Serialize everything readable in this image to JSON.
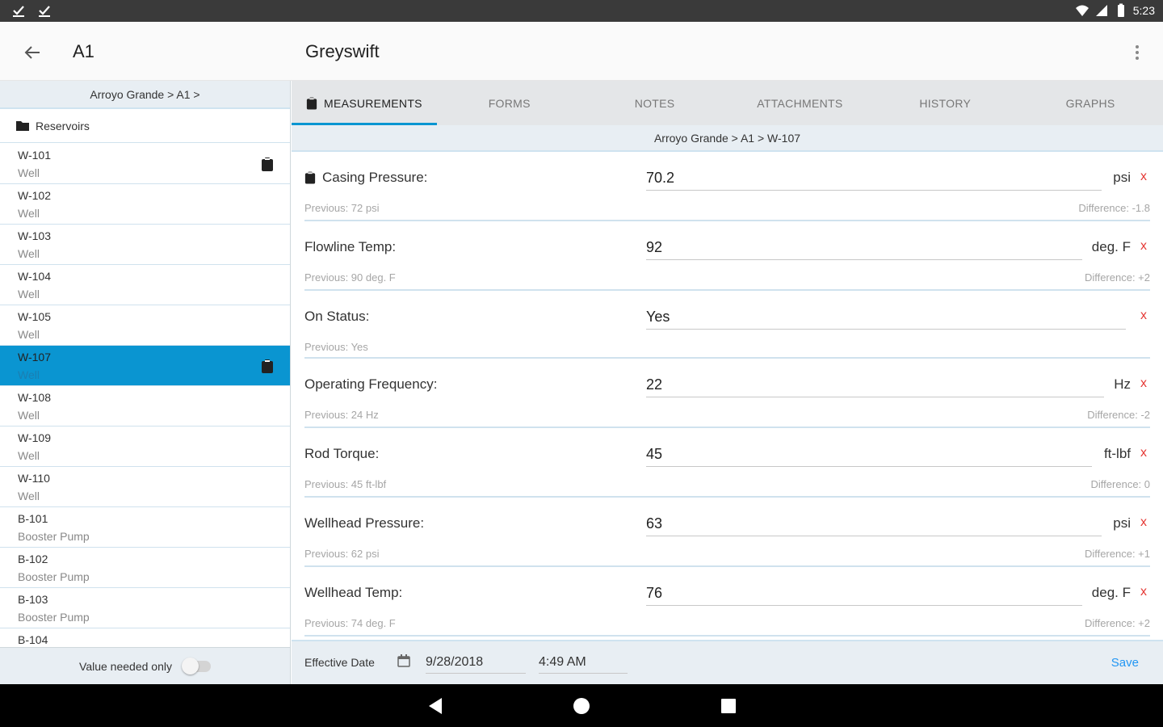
{
  "status_bar": {
    "time": "5:23"
  },
  "app_bar": {
    "left_title": "A1",
    "main_title": "Greyswift"
  },
  "left_pane": {
    "breadcrumb": "Arroyo Grande > A1 >",
    "folder_label": "Reservoirs",
    "items": [
      {
        "name": "W-101",
        "type": "Well"
      },
      {
        "name": "W-102",
        "type": "Well"
      },
      {
        "name": "W-103",
        "type": "Well"
      },
      {
        "name": "W-104",
        "type": "Well"
      },
      {
        "name": "W-105",
        "type": "Well"
      },
      {
        "name": "W-107",
        "type": "Well"
      },
      {
        "name": "W-108",
        "type": "Well"
      },
      {
        "name": "W-109",
        "type": "Well"
      },
      {
        "name": "W-110",
        "type": "Well"
      },
      {
        "name": "B-101",
        "type": "Booster Pump"
      },
      {
        "name": "B-102",
        "type": "Booster Pump"
      },
      {
        "name": "B-103",
        "type": "Booster Pump"
      },
      {
        "name": "B-104",
        "type": ""
      }
    ],
    "footer_label": "Value needed only"
  },
  "tabs": [
    "MEASUREMENTS",
    "FORMS",
    "NOTES",
    "ATTACHMENTS",
    "HISTORY",
    "GRAPHS"
  ],
  "right_pane": {
    "breadcrumb": "Arroyo Grande > A1 > W-107",
    "measurements": [
      {
        "label": "Casing Pressure:",
        "value": "70.2",
        "unit": "psi",
        "previous": "Previous: 72 psi",
        "difference": "Difference: -1.8"
      },
      {
        "label": "Flowline Temp:",
        "value": "92",
        "unit": "deg. F",
        "previous": "Previous: 90 deg. F",
        "difference": "Difference: +2"
      },
      {
        "label": "On Status:",
        "value": "Yes",
        "unit": "",
        "previous": "Previous: Yes",
        "difference": ""
      },
      {
        "label": "Operating Frequency:",
        "value": "22",
        "unit": "Hz",
        "previous": "Previous: 24 Hz",
        "difference": "Difference: -2"
      },
      {
        "label": "Rod Torque:",
        "value": "45",
        "unit": "ft-lbf",
        "previous": "Previous: 45 ft-lbf",
        "difference": "Difference: 0"
      },
      {
        "label": "Wellhead Pressure:",
        "value": "63",
        "unit": "psi",
        "previous": "Previous: 62 psi",
        "difference": "Difference: +1"
      },
      {
        "label": "Wellhead Temp:",
        "value": "76",
        "unit": "deg. F",
        "previous": "Previous: 74 deg. F",
        "difference": "Difference: +2"
      }
    ],
    "clear_symbol": "x",
    "footer": {
      "effective_label": "Effective Date",
      "date": "9/28/2018",
      "time": "4:49 AM",
      "save_label": "Save"
    }
  },
  "colors": {
    "accent": "#0a95d1",
    "clear": "#e53935",
    "save": "#2196f3"
  }
}
